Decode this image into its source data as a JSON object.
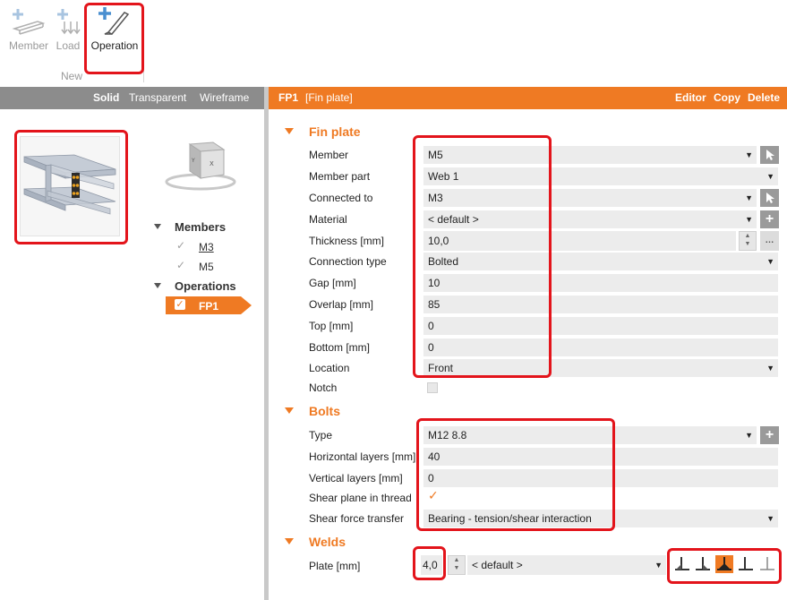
{
  "ribbon": {
    "buttons": [
      {
        "label": "Member"
      },
      {
        "label": "Load"
      },
      {
        "label": "Operation"
      }
    ],
    "group_label": "New"
  },
  "view_tabs": {
    "solid": "Solid",
    "transparent": "Transparent",
    "wireframe": "Wireframe"
  },
  "tree": {
    "members_heading": "Members",
    "members": [
      "M3",
      "M5"
    ],
    "operations_heading": "Operations",
    "operations": [
      "FP1"
    ]
  },
  "header": {
    "id": "FP1",
    "type": "[Fin plate]",
    "editor": "Editor",
    "copy": "Copy",
    "delete": "Delete"
  },
  "fin_plate": {
    "title": "Fin plate",
    "member": {
      "label": "Member",
      "value": "M5"
    },
    "member_part": {
      "label": "Member part",
      "value": "Web 1"
    },
    "connected_to": {
      "label": "Connected to",
      "value": "M3"
    },
    "material": {
      "label": "Material",
      "value": "< default >"
    },
    "thickness": {
      "label": "Thickness [mm]",
      "value": "10,0"
    },
    "connection_type": {
      "label": "Connection type",
      "value": "Bolted"
    },
    "gap": {
      "label": "Gap [mm]",
      "value": "10"
    },
    "overlap": {
      "label": "Overlap [mm]",
      "value": "85"
    },
    "top": {
      "label": "Top [mm]",
      "value": "0"
    },
    "bottom": {
      "label": "Bottom [mm]",
      "value": "0"
    },
    "location": {
      "label": "Location",
      "value": "Front"
    },
    "notch": {
      "label": "Notch"
    }
  },
  "bolts": {
    "title": "Bolts",
    "type": {
      "label": "Type",
      "value": "M12 8.8"
    },
    "horizontal_layers": {
      "label": "Horizontal layers [mm]",
      "value": "40"
    },
    "vertical_layers": {
      "label": "Vertical layers [mm]",
      "value": "0"
    },
    "shear_plane": {
      "label": "Shear plane in thread"
    },
    "shear_force": {
      "label": "Shear force transfer",
      "value": "Bearing - tension/shear interaction"
    }
  },
  "welds": {
    "title": "Welds",
    "plate": {
      "label": "Plate [mm]",
      "value": "4,0",
      "type": "< default >"
    }
  },
  "colors": {
    "accent": "#ef7a23",
    "highlight": "#e3141b",
    "panel_gray": "#8c8c8c"
  }
}
